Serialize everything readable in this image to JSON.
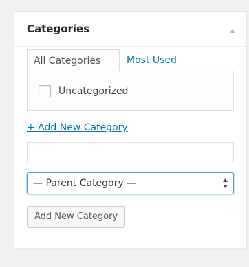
{
  "panel": {
    "title": "Categories",
    "toggle_icon": "triangle-up-icon"
  },
  "tabs": [
    {
      "label": "All Categories",
      "active": true
    },
    {
      "label": "Most Used",
      "active": false
    }
  ],
  "categories": [
    {
      "label": "Uncategorized",
      "checked": false
    }
  ],
  "add_link": "+ Add New Category",
  "new_category_input": {
    "value": "",
    "placeholder": ""
  },
  "parent_select": {
    "selected": "— Parent Category —"
  },
  "submit_button": "Add New Category",
  "colors": {
    "link": "#0073aa",
    "focus_border": "#5b9dd9",
    "background": "#f1f1f1"
  }
}
